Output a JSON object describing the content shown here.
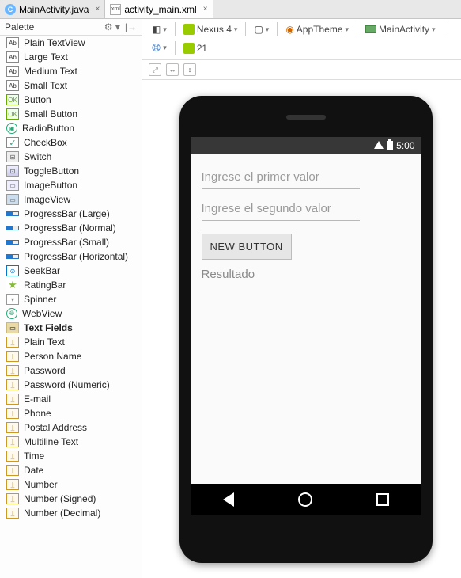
{
  "tabs": [
    {
      "label": "MainActivity.java",
      "icon": "C"
    },
    {
      "label": "activity_main.xml",
      "icon": "xml"
    }
  ],
  "palette": {
    "title": "Palette",
    "items": [
      {
        "label": "Plain TextView",
        "icon": "ab"
      },
      {
        "label": "Large Text",
        "icon": "ab"
      },
      {
        "label": "Medium Text",
        "icon": "ab"
      },
      {
        "label": "Small Text",
        "icon": "ab"
      },
      {
        "label": "Button",
        "icon": "ok"
      },
      {
        "label": "Small Button",
        "icon": "ok"
      },
      {
        "label": "RadioButton",
        "icon": "radio"
      },
      {
        "label": "CheckBox",
        "icon": "check"
      },
      {
        "label": "Switch",
        "icon": "switch"
      },
      {
        "label": "ToggleButton",
        "icon": "toggle"
      },
      {
        "label": "ImageButton",
        "icon": "imgbt"
      },
      {
        "label": "ImageView",
        "icon": "imgvw"
      },
      {
        "label": "ProgressBar (Large)",
        "icon": "bar"
      },
      {
        "label": "ProgressBar (Normal)",
        "icon": "bar"
      },
      {
        "label": "ProgressBar (Small)",
        "icon": "bar"
      },
      {
        "label": "ProgressBar (Horizontal)",
        "icon": "bar"
      },
      {
        "label": "SeekBar",
        "icon": "seek"
      },
      {
        "label": "RatingBar",
        "icon": "star"
      },
      {
        "label": "Spinner",
        "icon": "spinner"
      },
      {
        "label": "WebView",
        "icon": "web"
      },
      {
        "label": "Text Fields",
        "icon": "folder",
        "cat": true
      },
      {
        "label": "Plain Text",
        "icon": "field"
      },
      {
        "label": "Person Name",
        "icon": "field"
      },
      {
        "label": "Password",
        "icon": "field"
      },
      {
        "label": "Password (Numeric)",
        "icon": "field"
      },
      {
        "label": "E-mail",
        "icon": "field"
      },
      {
        "label": "Phone",
        "icon": "field"
      },
      {
        "label": "Postal Address",
        "icon": "field"
      },
      {
        "label": "Multiline Text",
        "icon": "field"
      },
      {
        "label": "Time",
        "icon": "field"
      },
      {
        "label": "Date",
        "icon": "field"
      },
      {
        "label": "Number",
        "icon": "field"
      },
      {
        "label": "Number (Signed)",
        "icon": "field"
      },
      {
        "label": "Number (Decimal)",
        "icon": "field"
      }
    ]
  },
  "toolbar": {
    "device": "Nexus 4",
    "theme": "AppTheme",
    "activity": "MainActivity",
    "api": "21"
  },
  "preview": {
    "status_time": "5:00",
    "hint1": "Ingrese el primer valor",
    "hint2": "Ingrese el segundo valor",
    "button_label": "NEW BUTTON",
    "result_text": "Resultado"
  }
}
